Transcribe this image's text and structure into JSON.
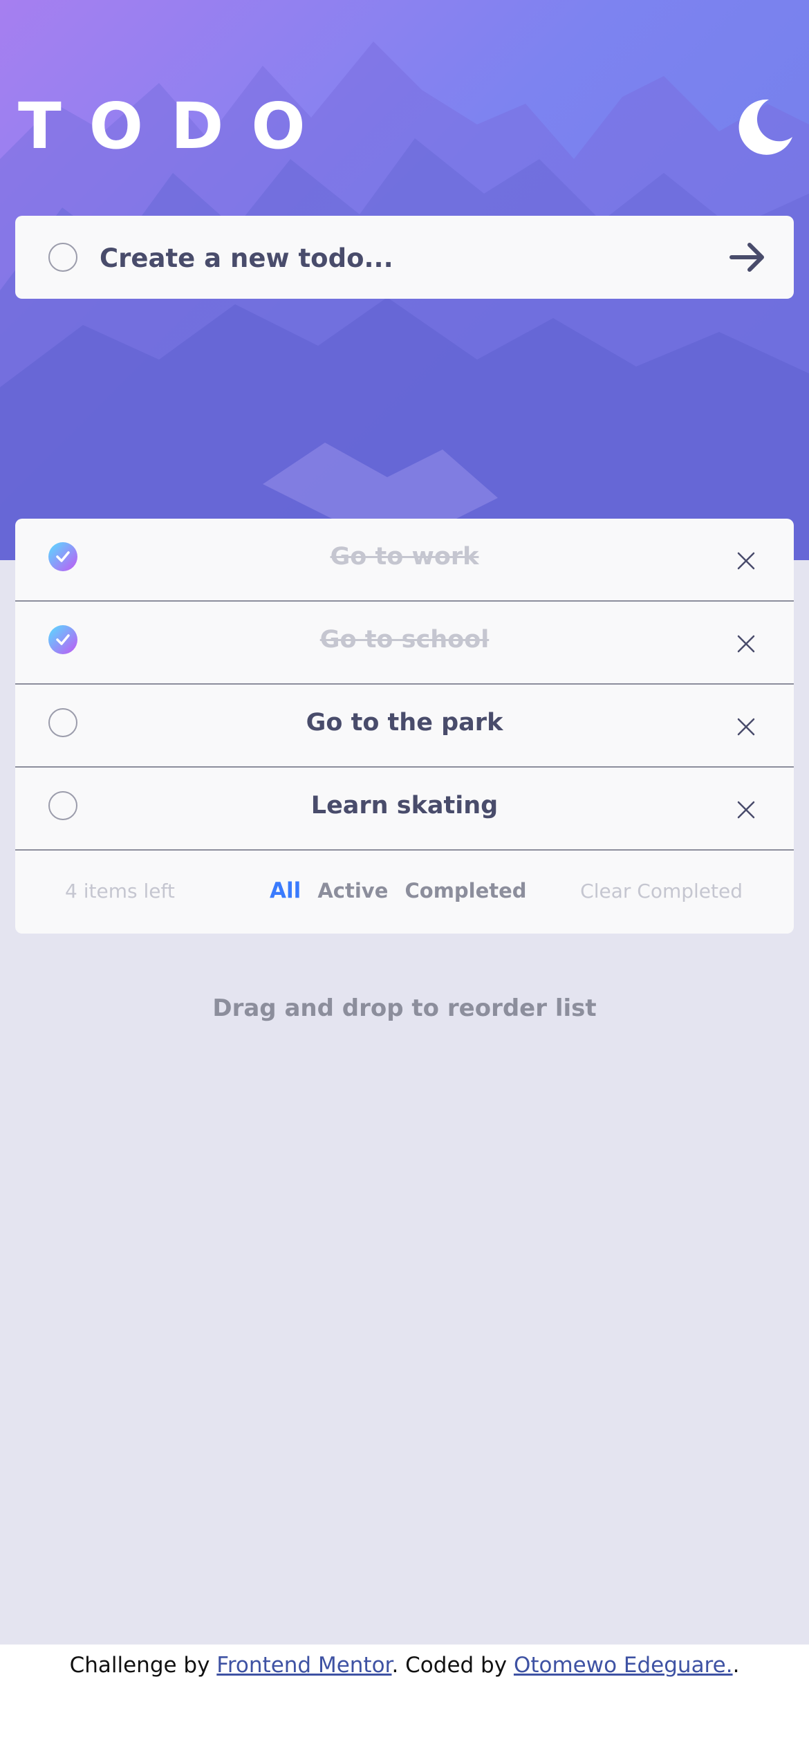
{
  "app": {
    "title": "TODO",
    "theme_toggle_icon": "moon-icon"
  },
  "new_todo": {
    "placeholder": "Create a new todo...",
    "submit_icon": "arrow-right-icon"
  },
  "todos": [
    {
      "text": "Go to work",
      "completed": true
    },
    {
      "text": "Go to school",
      "completed": true
    },
    {
      "text": "Go to the park",
      "completed": false
    },
    {
      "text": "Learn skating",
      "completed": false
    }
  ],
  "footer": {
    "items_left": "4 items left",
    "filters": [
      "All",
      "Active",
      "Completed"
    ],
    "active_filter": "All",
    "clear_completed": "Clear Completed"
  },
  "hint": "Drag and drop to reorder list",
  "attribution": {
    "prefix": "Challenge by ",
    "mentor_link": "Frontend Mentor",
    "middle": ". Coded by ",
    "author_link": "Otomewo Edeguare.",
    "suffix": "."
  },
  "colors": {
    "accent": "#3a7bfd",
    "check_gradient_start": "#57ddff",
    "check_gradient_end": "#c058f3",
    "text_primary": "#494c6b",
    "text_muted": "#c5c6d0",
    "background": "#e4e4f0"
  }
}
